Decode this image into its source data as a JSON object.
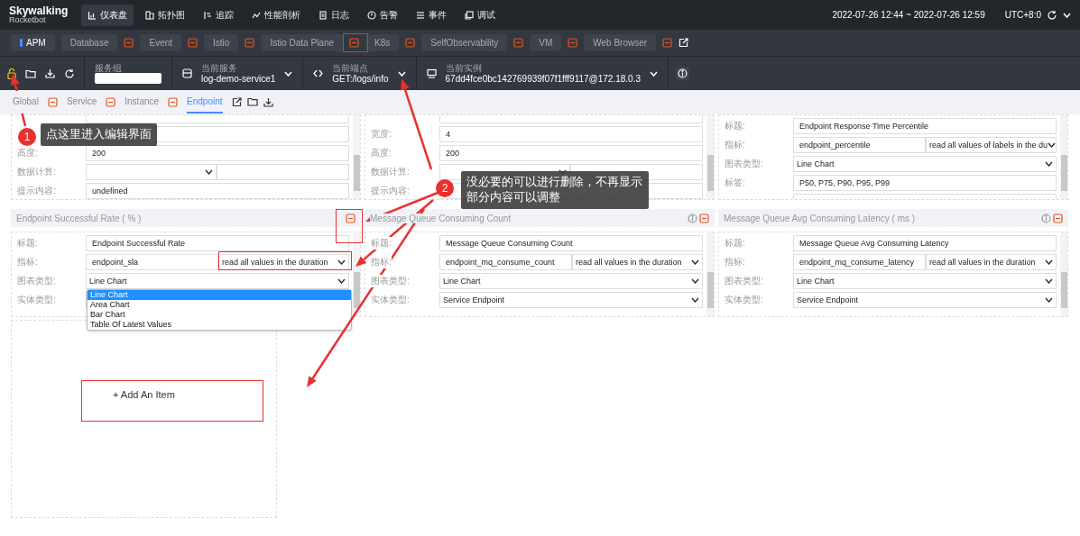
{
  "brand": {
    "name": "Skywalking",
    "subtitle": "Rocketbot"
  },
  "nav": [
    {
      "label": "仪表盘",
      "selected": true
    },
    {
      "label": "拓扑图",
      "selected": false
    },
    {
      "label": "追踪",
      "selected": false
    },
    {
      "label": "性能剖析",
      "selected": false
    },
    {
      "label": "日志",
      "selected": false
    },
    {
      "label": "告警",
      "selected": false
    },
    {
      "label": "事件",
      "selected": false
    },
    {
      "label": "调试",
      "selected": false
    }
  ],
  "time_range": "2022-07-26 12:44 ~ 2022-07-26 12:59",
  "timezone": "UTC+8:0",
  "dashboards": [
    {
      "label": "APM",
      "selected": true,
      "deletable": false
    },
    {
      "label": "Database",
      "selected": false,
      "deletable": true
    },
    {
      "label": "Event",
      "selected": false,
      "deletable": true
    },
    {
      "label": "Istio",
      "selected": false,
      "deletable": true
    },
    {
      "label": "Istio Data Plane",
      "selected": false,
      "deletable": true
    },
    {
      "label": "K8s",
      "selected": false,
      "deletable": true
    },
    {
      "label": "SelfObservability",
      "selected": false,
      "deletable": true
    },
    {
      "label": "VM",
      "selected": false,
      "deletable": true
    },
    {
      "label": "Web Browser",
      "selected": false,
      "deletable": true
    }
  ],
  "selectors": [
    {
      "label": "服务组",
      "kind": "input"
    },
    {
      "label": "当前服务",
      "kind": "select",
      "value": "log-demo-service1"
    },
    {
      "label": "当前端点",
      "kind": "select",
      "value": "GET:/logs/info"
    },
    {
      "label": "当前实例",
      "kind": "select",
      "value": "67dd4fce0bc142769939f07f1fff9117@172.18.0.3"
    }
  ],
  "pages": [
    {
      "label": "Global",
      "selected": false,
      "deletable": true
    },
    {
      "label": "Service",
      "selected": false,
      "deletable": true
    },
    {
      "label": "Instance",
      "selected": false,
      "deletable": true
    },
    {
      "label": "Endpoint",
      "selected": true,
      "deletable": false
    }
  ],
  "panels": [
    {
      "rows": [
        {
          "kind": "text"
        },
        {
          "kind": "text"
        },
        {
          "kind": "text",
          "label": "高度:",
          "value": "200"
        },
        {
          "kind": "calc",
          "label": "数据计算:"
        },
        {
          "kind": "text",
          "label": "提示内容:",
          "value": "undefined"
        }
      ]
    },
    {
      "rows": [
        {
          "kind": "text"
        },
        {
          "kind": "text",
          "label": "宽度:",
          "value": "4"
        },
        {
          "kind": "text",
          "label": "高度:",
          "value": "200"
        },
        {
          "kind": "calc",
          "label": "数据计算:"
        },
        {
          "kind": "text",
          "label": "提示内容:"
        }
      ]
    },
    {
      "rows": [
        {
          "kind": "text",
          "label": "标题:",
          "value": "Endpoint Response Time Percentile"
        },
        {
          "kind": "metric",
          "label": "指标:",
          "value": "endpoint_percentile",
          "select": "read all values of labels in the du"
        },
        {
          "kind": "select",
          "label": "图表类型:",
          "value": "Line Chart"
        },
        {
          "kind": "text",
          "label": "标签:",
          "value": "P50, P75, P90, P95, P99"
        },
        {
          "kind": "text"
        }
      ]
    },
    {
      "title": "Endpoint Successful Rate ( % )",
      "info": false,
      "rows": [
        {
          "kind": "text",
          "label": "标题:",
          "value": "Endpoint Successful Rate"
        },
        {
          "kind": "metric",
          "label": "指标:",
          "value": "endpoint_sla",
          "select": "read all values in the duration"
        },
        {
          "kind": "select",
          "label": "图表类型:",
          "value": "Line Chart"
        },
        {
          "kind": "select",
          "label": "实体类型:"
        }
      ],
      "dropdown": [
        {
          "label": "Line Chart",
          "selected": true
        },
        {
          "label": "Area Chart",
          "selected": false
        },
        {
          "label": "Bar Chart",
          "selected": false
        },
        {
          "label": "Table Of Latest Values",
          "selected": false
        }
      ]
    },
    {
      "title": "Message Queue Consuming Count",
      "info": true,
      "rows": [
        {
          "kind": "text",
          "label": "标题:",
          "value": "Message Queue Consuming Count"
        },
        {
          "kind": "metric",
          "label": "指标:",
          "value": "endpoint_mq_consume_count",
          "select": "read all values in the duration"
        },
        {
          "kind": "select",
          "label": "图表类型:",
          "value": "Line Chart"
        },
        {
          "kind": "select",
          "label": "实体类型:",
          "value": "Service Endpoint"
        }
      ]
    },
    {
      "title": "Message Queue Avg Consuming Latency ( ms )",
      "info": true,
      "rows": [
        {
          "kind": "text",
          "label": "标题:",
          "value": "Message Queue Avg Consuming Latency"
        },
        {
          "kind": "metric",
          "label": "指标:",
          "value": "endpoint_mq_consume_latency",
          "select": "read all values in the duration"
        },
        {
          "kind": "select",
          "label": "图表类型:",
          "value": "Line Chart"
        },
        {
          "kind": "select",
          "label": "实体类型:",
          "value": "Service Endpoint"
        }
      ]
    }
  ],
  "add_item": "+ Add An Item",
  "callouts": [
    {
      "number": "1",
      "text": "点这里进入编辑界面"
    },
    {
      "number": "2",
      "text": "没必要的可以进行删除，不再显示部分内容可以调整"
    }
  ]
}
